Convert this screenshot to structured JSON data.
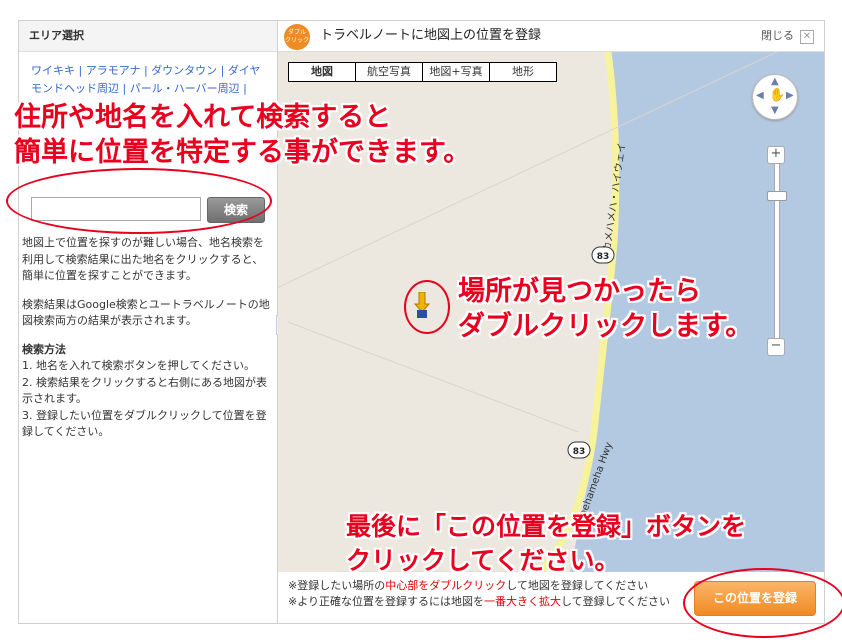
{
  "sidebar": {
    "title": "エリア選択",
    "areas": [
      "ワイキキ",
      "アラモアナ",
      "ダウンタウン",
      "ダイヤモンドヘッド周辺",
      "パール・ハーバー周辺"
    ],
    "search_button": "検索",
    "help_lines": [
      "地図上で位置を探すのが難しい場合、地名検索を利用して検索結果に出た地名をクリックすると、簡単に位置を探すことができます。",
      "検索結果はGoogle検索とユートラベルノートの地図検索両方の結果が表示されます。"
    ],
    "method_title": "検索方法",
    "method_steps": [
      "1. 地名を入れて検索ボタンを押してください。",
      "2. 検索結果をクリックすると右側にある地図が表示されます。",
      "3. 登録したい位置をダブルクリックして位置を登録してください。"
    ]
  },
  "header": {
    "badge_line1": "ダブル",
    "badge_line2": "クリック",
    "title": "トラベルノートに地図上の位置を登録",
    "close_label": "閉じる"
  },
  "map": {
    "types": [
      "地図",
      "航空写真",
      "地図+写真",
      "地形"
    ],
    "selected_type": "地図",
    "road_label_1": "カメハメハ・ハイウェイ",
    "road_label_2": "Kamehameha Hwy",
    "route_shield": "83",
    "water_color": "#b3c9e1",
    "land_color": "#ece8df",
    "road_color": "#f7f39c"
  },
  "notes": {
    "line1_a": "※登録したい場所の",
    "line1_red": "中心部をダブルクリック",
    "line1_b": "して地図を登録してください",
    "line2_a": "※より正確な位置を登録するには地図を",
    "line2_red": "一番大きく拡大",
    "line2_b": "して登録してください"
  },
  "register_button": "この位置を登録",
  "callouts": {
    "search_1": "住所や地名を入れて検索すると",
    "search_2": "簡単に位置を特定する事ができます。",
    "double_1": "場所が見つかったら",
    "double_2": "ダブルクリックします。",
    "final_1": "最後に「この位置を登録」ボタンを",
    "final_2": "クリックしてください。"
  }
}
